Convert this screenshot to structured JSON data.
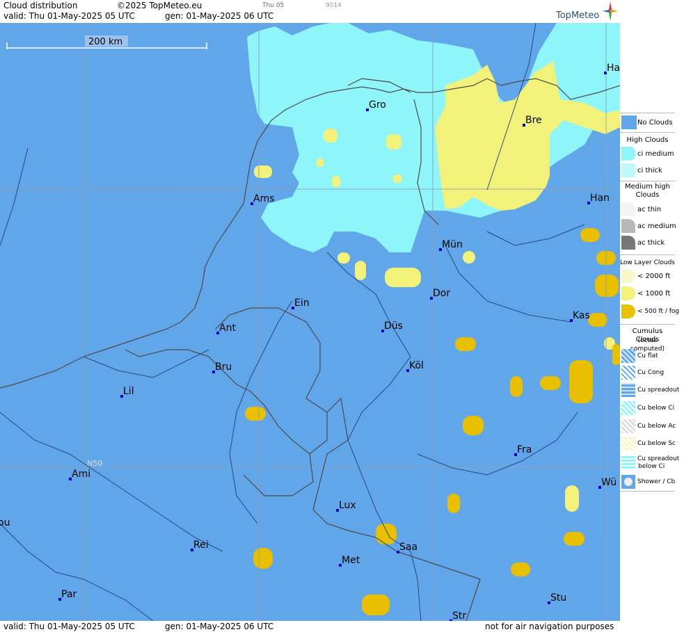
{
  "header": {
    "title": "Cloud distribution",
    "copyright": "©2025 TopMeteo.eu",
    "valid": "valid:  Thu  01-May-2025  05 UTC",
    "gen": "gen: 01-May-2025 06 UTC",
    "small_time": "Thu 05",
    "small_code": "9014",
    "brand": "TopMeteo"
  },
  "footer": {
    "valid": "valid:  Thu  01-May-2025  05 UTC",
    "gen": "gen: 01-May-2025 06 UTC",
    "disclaimer": "not for air navigation purposes"
  },
  "map": {
    "scale_label": "200 km",
    "lat_label": "N50",
    "colors": {
      "no_clouds": "#62a6ea",
      "ci_medium": "#8ef6f8",
      "low_1000": "#f2f27a",
      "fog": "#e9c000"
    },
    "cities": [
      {
        "name": "Gro"
      },
      {
        "name": "Bre"
      },
      {
        "name": "Ha"
      },
      {
        "name": "Ams"
      },
      {
        "name": "Han"
      },
      {
        "name": "Mün"
      },
      {
        "name": "Dor"
      },
      {
        "name": "Ein"
      },
      {
        "name": "Ant"
      },
      {
        "name": "Düs"
      },
      {
        "name": "Kas"
      },
      {
        "name": "Bru"
      },
      {
        "name": "Köl"
      },
      {
        "name": "Lil"
      },
      {
        "name": "Fra"
      },
      {
        "name": "Ami"
      },
      {
        "name": "Wü"
      },
      {
        "name": "Lux"
      },
      {
        "name": "Rei"
      },
      {
        "name": "Saa"
      },
      {
        "name": "Met"
      },
      {
        "name": "Par"
      },
      {
        "name": "Stu"
      },
      {
        "name": "Str"
      },
      {
        "name": "ou"
      }
    ]
  },
  "legend": {
    "no_clouds": "No Clouds",
    "high_title": "High Clouds",
    "ci_medium": "ci medium",
    "ci_thick": "ci thick",
    "medium_title": "Medium high Clouds",
    "ac_thin": "ac thin",
    "ac_medium": "ac medium",
    "ac_thick": "ac thick",
    "low_title": "Low Layer Clouds",
    "low_2000": "< 2000 ft",
    "low_1000": "< 1000 ft",
    "low_500": "< 500 ft / fog",
    "cumulus_title": "Cumulus Clouds",
    "cumulus_sub": "(octas computed)",
    "cu_flat": "Cu flat",
    "cu_cong": "Cu Cong",
    "cu_spreadout": "Cu spreadout",
    "cu_below_ci": "Cu below Ci",
    "cu_below_ac": "Cu below Ac",
    "cu_below_sc": "Cu below Sc",
    "cu_spreadout_below_ci_1": "Cu spreadout",
    "cu_spreadout_below_ci_2": "below Ci",
    "shower": "Shower / Cb"
  }
}
